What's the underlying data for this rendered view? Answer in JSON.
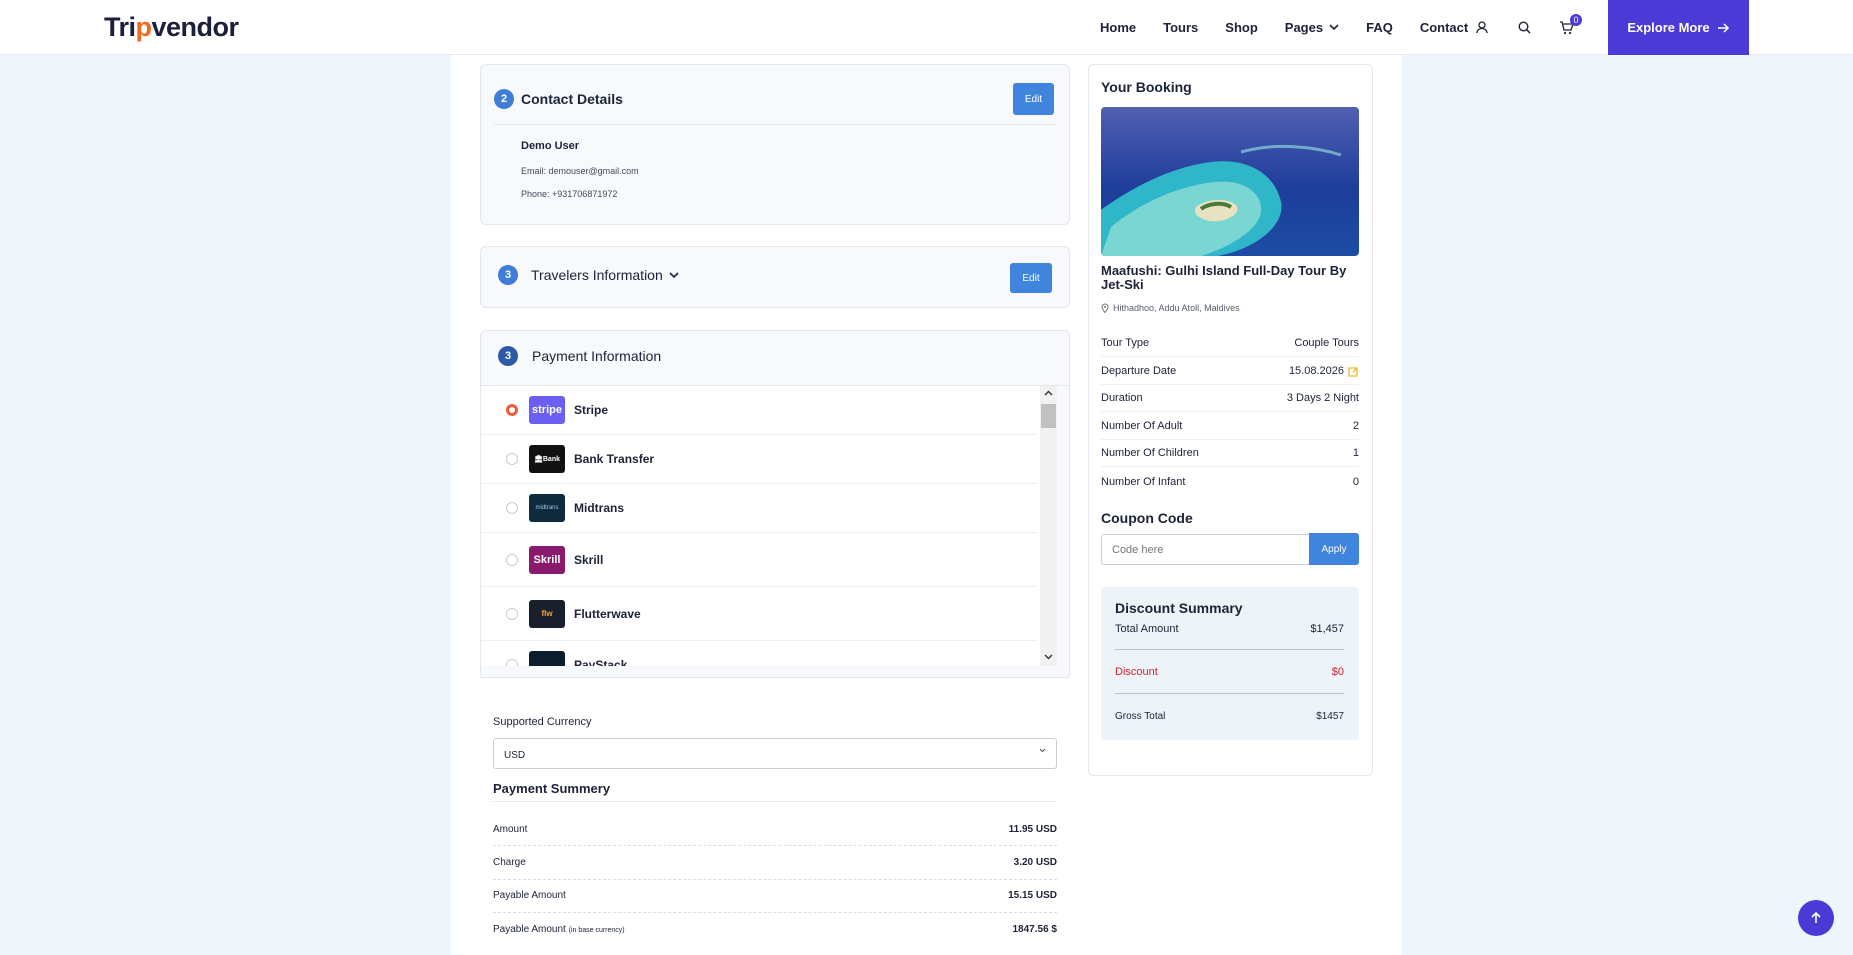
{
  "header": {
    "logo_prefix": "Tri",
    "logo_accent": "p",
    "logo_suffix": "vendor",
    "nav": [
      "Home",
      "Tours",
      "Shop",
      "Pages",
      "FAQ",
      "Contact"
    ],
    "cart_count": "0",
    "explore_label": "Explore More"
  },
  "contact": {
    "step": "2",
    "title": "Contact Details",
    "edit_label": "Edit",
    "name": "Demo User",
    "email": "Email: demouser@gmail.com",
    "phone": "Phone: +931706871972"
  },
  "travelers": {
    "step": "3",
    "title": "Travelers Information",
    "edit_label": "Edit"
  },
  "payment": {
    "step": "3",
    "title": "Payment Information",
    "methods": [
      {
        "name": "Stripe",
        "logo": "stripe",
        "color": "#6a5ff2"
      },
      {
        "name": "Bank Transfer",
        "logo": "Bank",
        "color": "#111111"
      },
      {
        "name": "Midtrans",
        "logo": "midtrans",
        "color": "#0f2a3d"
      },
      {
        "name": "Skrill",
        "logo": "Skrill",
        "color": "#8a1a6e"
      },
      {
        "name": "Flutterwave",
        "logo": "flw",
        "color": "#1a1f2e"
      },
      {
        "name": "PayStack",
        "logo": "",
        "color": "#0b1d2e"
      }
    ]
  },
  "currency": {
    "label": "Supported Currency",
    "selected": "USD"
  },
  "payment_summary": {
    "title": "Payment Summery",
    "rows": [
      {
        "label": "Amount",
        "value": "11.95 USD"
      },
      {
        "label": "Charge",
        "value": "3.20 USD"
      },
      {
        "label": "Payable Amount",
        "value": "15.15 USD"
      },
      {
        "label": "Payable Amount",
        "note": "(in base currency)",
        "value": "1847.56 $"
      }
    ]
  },
  "booking": {
    "title": "Your Booking",
    "tour_name": "Maafushi: Gulhi Island Full-Day Tour By Jet-Ski",
    "location": "Hithadhoo, Addu Atoll, Maldives",
    "details": [
      {
        "label": "Tour Type",
        "value": "Couple Tours"
      },
      {
        "label": "Departure Date",
        "value": "15.08.2026"
      },
      {
        "label": "Duration",
        "value": "3 Days 2 Night"
      },
      {
        "label": "Number Of Adult",
        "value": "2"
      },
      {
        "label": "Number Of Children",
        "value": "1"
      },
      {
        "label": "Number Of Infant",
        "value": "0"
      }
    ],
    "coupon_title": "Coupon Code",
    "coupon_placeholder": "Code here",
    "apply_label": "Apply",
    "discount": {
      "title": "Discount Summary",
      "total_label": "Total Amount",
      "total_value": "$1,457",
      "discount_label": "Discount",
      "discount_value": "$0",
      "gross_label": "Gross Total",
      "gross_value": "$1457"
    }
  },
  "colors": {
    "brand": "#4b3ad6",
    "accent": "#f26a21",
    "primary_button": "#3f85de",
    "discount_red": "#d0202f"
  }
}
